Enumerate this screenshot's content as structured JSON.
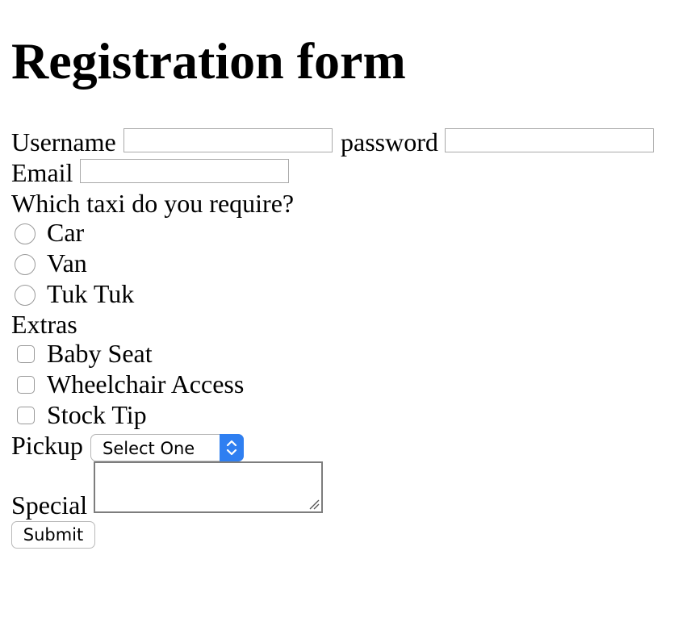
{
  "title": "Registration form",
  "fields": {
    "username_label": "Username",
    "username_value": "",
    "password_label": "password",
    "password_value": "",
    "email_label": "Email",
    "email_value": ""
  },
  "taxi": {
    "question": "Which taxi do you require?",
    "options": [
      "Car",
      "Van",
      "Tuk Tuk"
    ]
  },
  "extras": {
    "label": "Extras",
    "options": [
      "Baby Seat",
      "Wheelchair Access",
      "Stock Tip"
    ]
  },
  "pickup": {
    "label": "Pickup",
    "selected": "Select One"
  },
  "special": {
    "label": "Special",
    "value": ""
  },
  "submit_label": "Submit"
}
